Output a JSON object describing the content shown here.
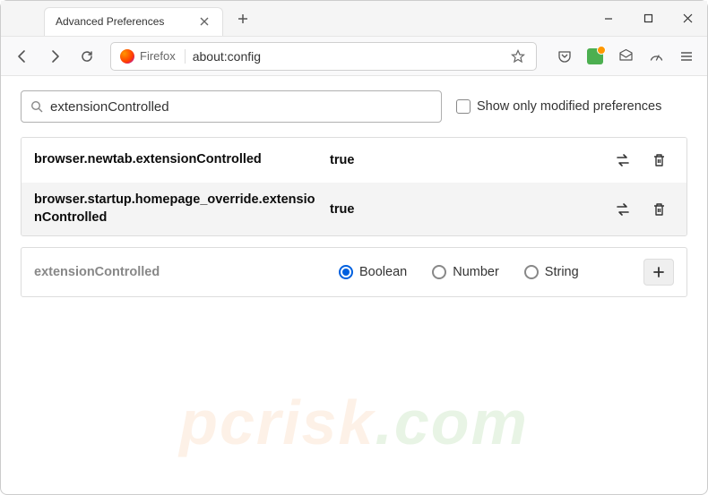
{
  "window": {
    "tab_title": "Advanced Preferences"
  },
  "urlbar": {
    "identity": "Firefox",
    "url": "about:config"
  },
  "page": {
    "search_value": "extensionControlled",
    "filter_label": "Show only modified preferences"
  },
  "prefs": [
    {
      "name": "browser.newtab.extensionControlled",
      "value": "true"
    },
    {
      "name": "browser.startup.homepage_override.extensionControlled",
      "value": "true"
    }
  ],
  "new_pref": {
    "name": "extensionControlled",
    "types": [
      "Boolean",
      "Number",
      "String"
    ],
    "selected": "Boolean"
  },
  "watermark": {
    "text": "pcrisk",
    "suffix": ".com"
  }
}
